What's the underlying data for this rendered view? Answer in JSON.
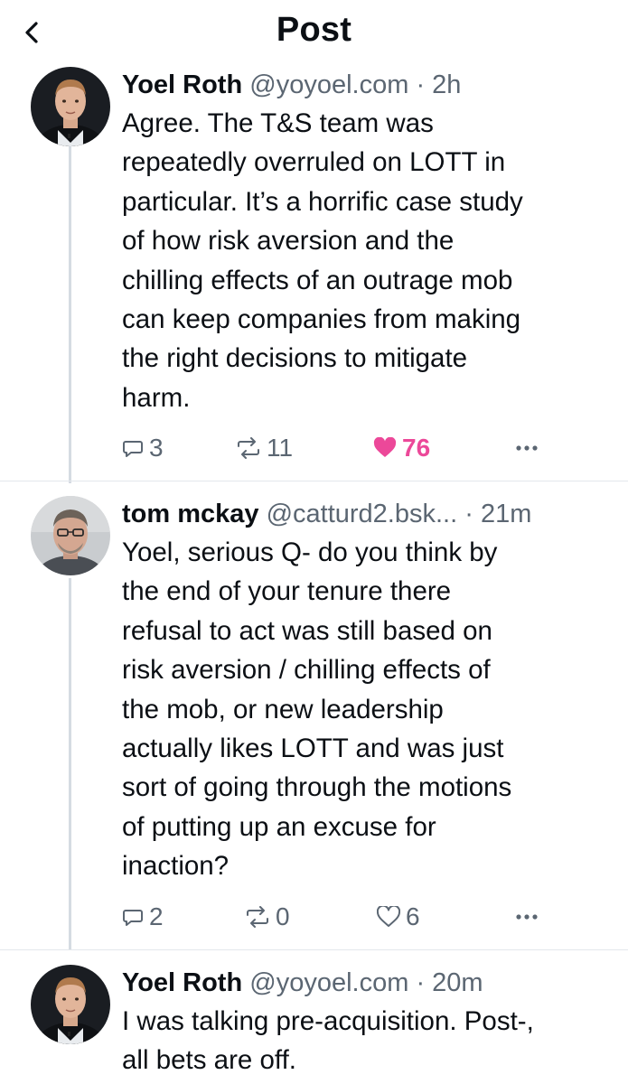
{
  "header": {
    "title": "Post",
    "back_icon": "chevron-left-icon"
  },
  "posts": [
    {
      "author": {
        "name": "Yoel Roth",
        "handle": "@yoyoel.com",
        "separator": "·",
        "time": "2h"
      },
      "text": "Agree. The T&S team was\nrepeatedly overruled on LOTT in\nparticular. It’s a horrific case study\nof how risk aversion and the\nchilling effects of an outrage mob\ncan keep companies from making\nthe right decisions to mitigate\nharm.",
      "actions": {
        "replies": "3",
        "reposts": "11",
        "likes": "76",
        "liked": true
      }
    },
    {
      "author": {
        "name": "tom mckay",
        "handle": "@catturd2.bsk...",
        "separator": "·",
        "time": "21m"
      },
      "text": "Yoel, serious Q- do you think by\nthe end of your tenure there\nrefusal to act was still based on\nrisk aversion / chilling effects of\nthe mob, or new leadership\nactually likes LOTT and was just\nsort of going through the motions\nof putting up an excuse for\ninaction?",
      "actions": {
        "replies": "2",
        "reposts": "0",
        "likes": "6",
        "liked": false
      }
    },
    {
      "author": {
        "name": "Yoel Roth",
        "handle": "@yoyoel.com",
        "separator": "·",
        "time": "20m"
      },
      "text": "I was talking pre-acquisition. Post-,\nall bets are off."
    }
  ],
  "icons": {
    "reply": "speech-bubble-icon",
    "repost": "repost-arrows-icon",
    "like": "heart-icon",
    "more": "ellipsis-icon"
  },
  "colors": {
    "text": "#0b0f14",
    "muted": "#5b6672",
    "like_active": "#ec4899",
    "divider": "#e3e7ec",
    "thread_line": "#d5dbe2"
  }
}
